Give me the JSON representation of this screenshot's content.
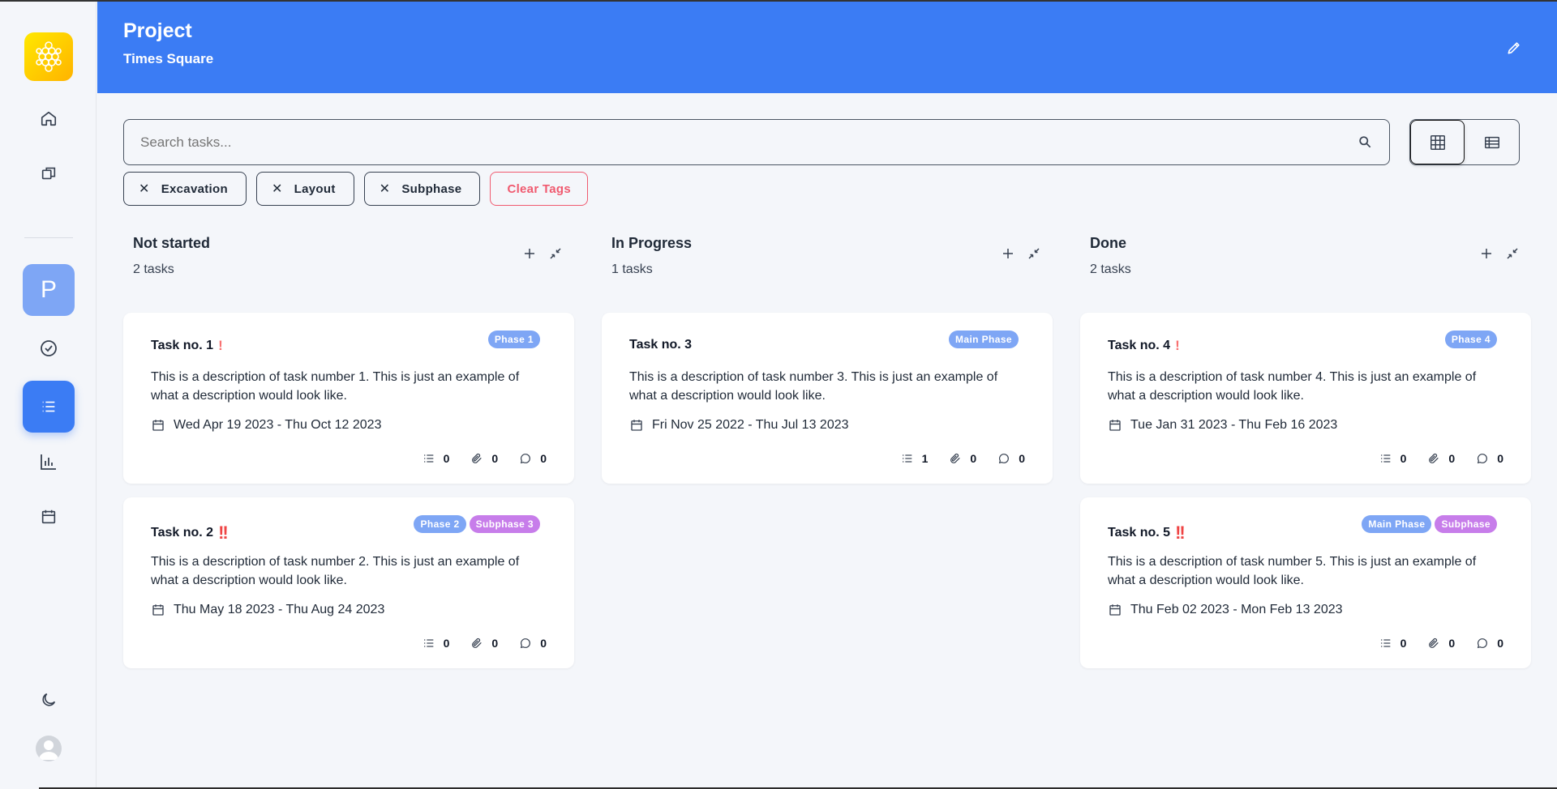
{
  "header": {
    "title": "Project",
    "subtitle": "Times Square"
  },
  "sidebar": {
    "project_initial": "P"
  },
  "search": {
    "placeholder": "Search tasks..."
  },
  "tags": [
    "Excavation",
    "Layout",
    "Subphase"
  ],
  "clear_tags_label": "Clear Tags",
  "columns": [
    {
      "title": "Not started",
      "count": "2 tasks",
      "cards": [
        {
          "title": "Task no. 1",
          "priority": "!",
          "badges": [
            "Phase 1"
          ],
          "description": "This is a description of task number 1. This is just an example of what a description would look like.",
          "dates": "Wed Apr 19 2023 - Thu Oct 12 2023",
          "subtasks": "0",
          "attachments": "0",
          "comments": "0"
        },
        {
          "title": "Task no. 2",
          "priority": "!!",
          "badges": [
            "Phase 2",
            "Subphase 3"
          ],
          "description": "This is a description of task number 2. This is just an example of what a description would look like.",
          "dates": "Thu May 18 2023 - Thu Aug 24 2023",
          "subtasks": "0",
          "attachments": "0",
          "comments": "0"
        }
      ]
    },
    {
      "title": "In Progress",
      "count": "1 tasks",
      "cards": [
        {
          "title": "Task no. 3",
          "priority": "",
          "badges": [
            "Main Phase"
          ],
          "description": "This is a description of task number 3. This is just an example of what a description would look like.",
          "dates": "Fri Nov 25 2022 - Thu Jul 13 2023",
          "subtasks": "1",
          "attachments": "0",
          "comments": "0"
        }
      ]
    },
    {
      "title": "Done",
      "count": "2 tasks",
      "cards": [
        {
          "title": "Task no. 4",
          "priority": "!",
          "badges": [
            "Phase 4"
          ],
          "description": "This is a description of task number 4. This is just an example of what a description would look like.",
          "dates": "Tue Jan 31 2023 - Thu Feb 16 2023",
          "subtasks": "0",
          "attachments": "0",
          "comments": "0"
        },
        {
          "title": "Task no. 5",
          "priority": "!!",
          "badges": [
            "Main Phase",
            "Subphase"
          ],
          "description": "This is a description of task number 5. This is just an example of what a description would look like.",
          "dates": "Thu Feb 02 2023 - Mon Feb 13 2023",
          "subtasks": "0",
          "attachments": "0",
          "comments": "0"
        }
      ]
    }
  ],
  "colors": {
    "primary": "#3b7cf4",
    "badge_blue": "#7ea6f5",
    "badge_purple": "#c77dea",
    "danger": "#ef4444"
  },
  "icons": [
    "logo-hexagon-icon",
    "home-icon",
    "copy-icon",
    "check-circle-icon",
    "list-icon",
    "bar-chart-icon",
    "calendar-icon",
    "moon-icon",
    "user-avatar-icon",
    "pencil-icon",
    "search-icon",
    "grid-view-icon",
    "table-view-icon",
    "plus-icon",
    "collapse-icon",
    "attachment-icon",
    "comment-icon"
  ]
}
